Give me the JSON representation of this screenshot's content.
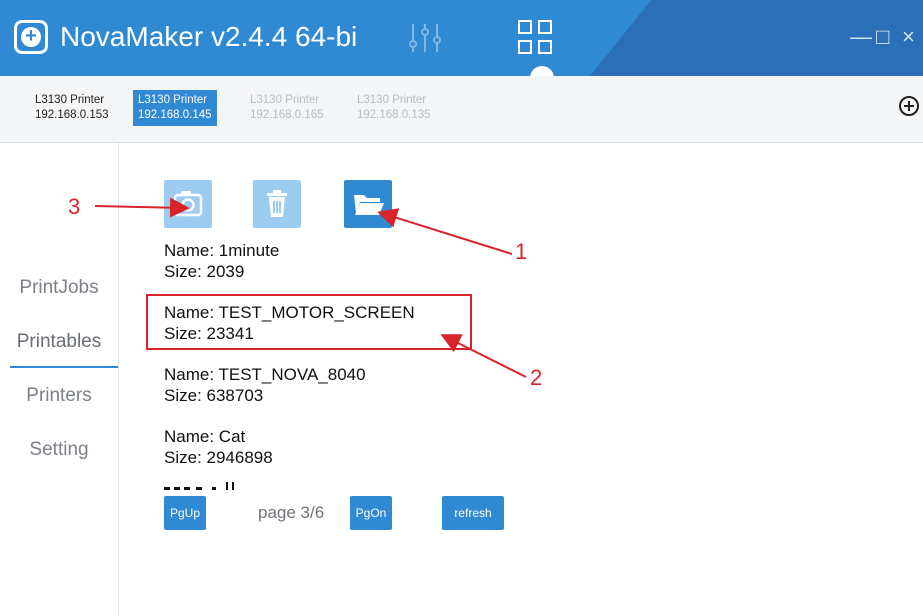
{
  "app": {
    "title": "NovaMaker v2.4.4 64-bi",
    "window_controls": [
      "—",
      "□",
      "×"
    ]
  },
  "printers": [
    {
      "name": "L3130 Printer",
      "ip": "192.168.0.153",
      "state": "normal"
    },
    {
      "name": "L3130 Printer",
      "ip": "192.168.0.145",
      "state": "active"
    },
    {
      "name": "L3130 Printer",
      "ip": "192.168.0.165",
      "state": "dim"
    },
    {
      "name": "L3130 Printer",
      "ip": "192.168.0.135",
      "state": "dim"
    }
  ],
  "sidebar": {
    "items": [
      {
        "label": "PrintJobs"
      },
      {
        "label": "Printables",
        "active": true
      },
      {
        "label": "Printers"
      },
      {
        "label": "Setting"
      }
    ]
  },
  "toolbar": {
    "buttons": [
      {
        "icon": "camera-icon"
      },
      {
        "icon": "trash-icon"
      },
      {
        "icon": "folder-open-icon"
      }
    ]
  },
  "files": [
    {
      "name": "Name: 1minute",
      "size": "Size: 2039"
    },
    {
      "name": "Name: TEST_MOTOR_SCREEN",
      "size": "Size: 23341",
      "highlighted": true
    },
    {
      "name": "Name: TEST_NOVA_8040",
      "size": "Size: 638703"
    },
    {
      "name": "Name: Cat",
      "size": "Size: 2946898"
    }
  ],
  "pager": {
    "prev_label": "PgUp",
    "page_label": "page 3/6",
    "next_label": "PgOn",
    "refresh_label": "refresh"
  },
  "annotations": {
    "one": "1",
    "two": "2",
    "three": "3"
  },
  "colors": {
    "accent": "#2f8ad3",
    "annotation_red": "#d8232a"
  }
}
